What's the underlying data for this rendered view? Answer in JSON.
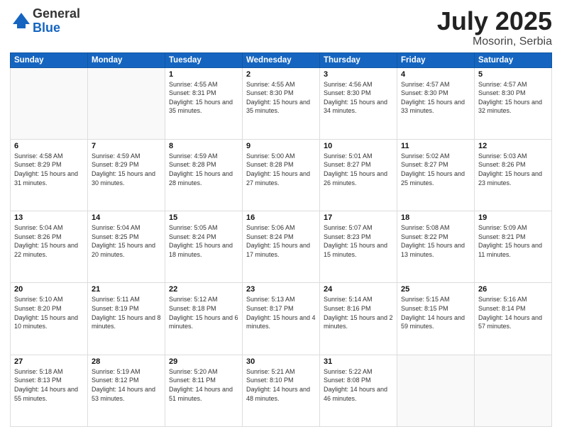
{
  "header": {
    "logo_general": "General",
    "logo_blue": "Blue",
    "title": "July 2025",
    "subtitle": "Mosorin, Serbia"
  },
  "days_of_week": [
    "Sunday",
    "Monday",
    "Tuesday",
    "Wednesday",
    "Thursday",
    "Friday",
    "Saturday"
  ],
  "weeks": [
    [
      {
        "day": "",
        "info": ""
      },
      {
        "day": "",
        "info": ""
      },
      {
        "day": "1",
        "info": "Sunrise: 4:55 AM\nSunset: 8:31 PM\nDaylight: 15 hours and 35 minutes."
      },
      {
        "day": "2",
        "info": "Sunrise: 4:55 AM\nSunset: 8:30 PM\nDaylight: 15 hours and 35 minutes."
      },
      {
        "day": "3",
        "info": "Sunrise: 4:56 AM\nSunset: 8:30 PM\nDaylight: 15 hours and 34 minutes."
      },
      {
        "day": "4",
        "info": "Sunrise: 4:57 AM\nSunset: 8:30 PM\nDaylight: 15 hours and 33 minutes."
      },
      {
        "day": "5",
        "info": "Sunrise: 4:57 AM\nSunset: 8:30 PM\nDaylight: 15 hours and 32 minutes."
      }
    ],
    [
      {
        "day": "6",
        "info": "Sunrise: 4:58 AM\nSunset: 8:29 PM\nDaylight: 15 hours and 31 minutes."
      },
      {
        "day": "7",
        "info": "Sunrise: 4:59 AM\nSunset: 8:29 PM\nDaylight: 15 hours and 30 minutes."
      },
      {
        "day": "8",
        "info": "Sunrise: 4:59 AM\nSunset: 8:28 PM\nDaylight: 15 hours and 28 minutes."
      },
      {
        "day": "9",
        "info": "Sunrise: 5:00 AM\nSunset: 8:28 PM\nDaylight: 15 hours and 27 minutes."
      },
      {
        "day": "10",
        "info": "Sunrise: 5:01 AM\nSunset: 8:27 PM\nDaylight: 15 hours and 26 minutes."
      },
      {
        "day": "11",
        "info": "Sunrise: 5:02 AM\nSunset: 8:27 PM\nDaylight: 15 hours and 25 minutes."
      },
      {
        "day": "12",
        "info": "Sunrise: 5:03 AM\nSunset: 8:26 PM\nDaylight: 15 hours and 23 minutes."
      }
    ],
    [
      {
        "day": "13",
        "info": "Sunrise: 5:04 AM\nSunset: 8:26 PM\nDaylight: 15 hours and 22 minutes."
      },
      {
        "day": "14",
        "info": "Sunrise: 5:04 AM\nSunset: 8:25 PM\nDaylight: 15 hours and 20 minutes."
      },
      {
        "day": "15",
        "info": "Sunrise: 5:05 AM\nSunset: 8:24 PM\nDaylight: 15 hours and 18 minutes."
      },
      {
        "day": "16",
        "info": "Sunrise: 5:06 AM\nSunset: 8:24 PM\nDaylight: 15 hours and 17 minutes."
      },
      {
        "day": "17",
        "info": "Sunrise: 5:07 AM\nSunset: 8:23 PM\nDaylight: 15 hours and 15 minutes."
      },
      {
        "day": "18",
        "info": "Sunrise: 5:08 AM\nSunset: 8:22 PM\nDaylight: 15 hours and 13 minutes."
      },
      {
        "day": "19",
        "info": "Sunrise: 5:09 AM\nSunset: 8:21 PM\nDaylight: 15 hours and 11 minutes."
      }
    ],
    [
      {
        "day": "20",
        "info": "Sunrise: 5:10 AM\nSunset: 8:20 PM\nDaylight: 15 hours and 10 minutes."
      },
      {
        "day": "21",
        "info": "Sunrise: 5:11 AM\nSunset: 8:19 PM\nDaylight: 15 hours and 8 minutes."
      },
      {
        "day": "22",
        "info": "Sunrise: 5:12 AM\nSunset: 8:18 PM\nDaylight: 15 hours and 6 minutes."
      },
      {
        "day": "23",
        "info": "Sunrise: 5:13 AM\nSunset: 8:17 PM\nDaylight: 15 hours and 4 minutes."
      },
      {
        "day": "24",
        "info": "Sunrise: 5:14 AM\nSunset: 8:16 PM\nDaylight: 15 hours and 2 minutes."
      },
      {
        "day": "25",
        "info": "Sunrise: 5:15 AM\nSunset: 8:15 PM\nDaylight: 14 hours and 59 minutes."
      },
      {
        "day": "26",
        "info": "Sunrise: 5:16 AM\nSunset: 8:14 PM\nDaylight: 14 hours and 57 minutes."
      }
    ],
    [
      {
        "day": "27",
        "info": "Sunrise: 5:18 AM\nSunset: 8:13 PM\nDaylight: 14 hours and 55 minutes."
      },
      {
        "day": "28",
        "info": "Sunrise: 5:19 AM\nSunset: 8:12 PM\nDaylight: 14 hours and 53 minutes."
      },
      {
        "day": "29",
        "info": "Sunrise: 5:20 AM\nSunset: 8:11 PM\nDaylight: 14 hours and 51 minutes."
      },
      {
        "day": "30",
        "info": "Sunrise: 5:21 AM\nSunset: 8:10 PM\nDaylight: 14 hours and 48 minutes."
      },
      {
        "day": "31",
        "info": "Sunrise: 5:22 AM\nSunset: 8:08 PM\nDaylight: 14 hours and 46 minutes."
      },
      {
        "day": "",
        "info": ""
      },
      {
        "day": "",
        "info": ""
      }
    ]
  ]
}
